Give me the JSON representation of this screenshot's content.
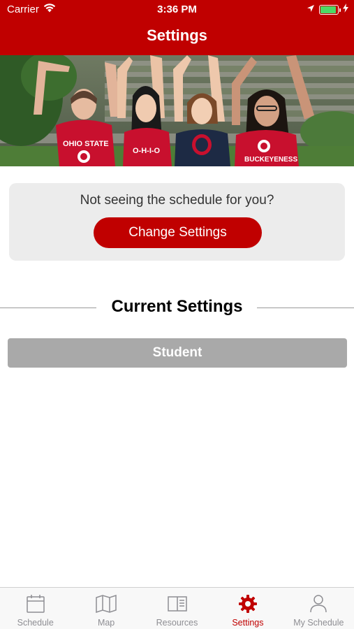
{
  "status_bar": {
    "carrier": "Carrier",
    "time": "3:36 PM"
  },
  "header": {
    "title": "Settings"
  },
  "hero": {
    "shirt_text_1": "OHIO STATE",
    "shirt_text_2": "O-H-I-O",
    "shirt_text_3": "BUCKEYENESS"
  },
  "prompt": {
    "text": "Not seeing the schedule for you?",
    "button_label": "Change Settings"
  },
  "current_settings": {
    "title": "Current Settings",
    "value": "Student"
  },
  "tabs": [
    {
      "label": "Schedule",
      "icon": "calendar-icon",
      "active": false
    },
    {
      "label": "Map",
      "icon": "map-icon",
      "active": false
    },
    {
      "label": "Resources",
      "icon": "book-icon",
      "active": false
    },
    {
      "label": "Settings",
      "icon": "gear-icon",
      "active": true
    },
    {
      "label": "My Schedule",
      "icon": "person-icon",
      "active": false
    }
  ],
  "colors": {
    "brand": "#c00000",
    "battery": "#4cd964",
    "setting_bar": "#a9a9a9",
    "inactive_tab": "#8e8e93"
  }
}
